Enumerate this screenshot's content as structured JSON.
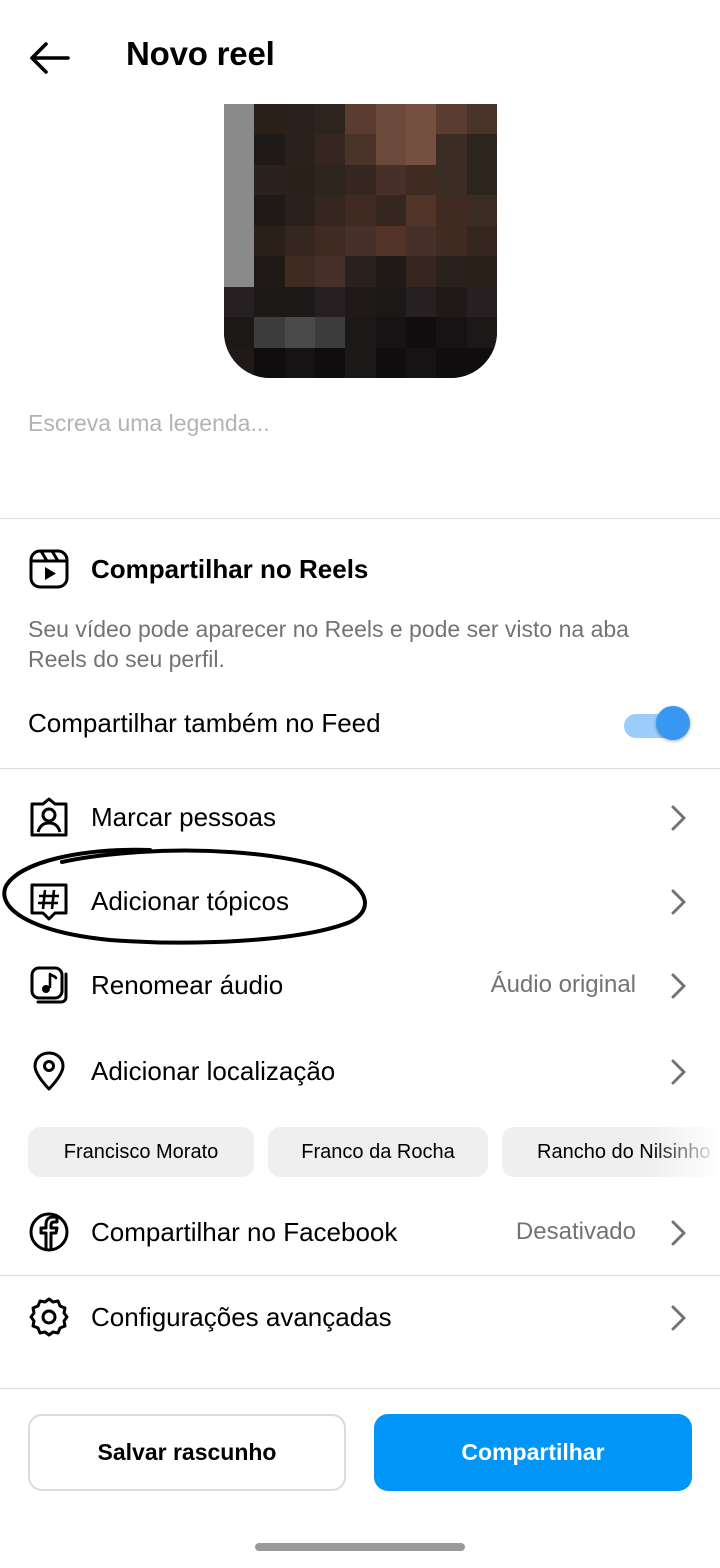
{
  "header": {
    "title": "Novo reel",
    "back_icon": "arrow-left-icon"
  },
  "caption": {
    "placeholder": "Escreva uma legenda..."
  },
  "reels_section": {
    "icon": "reels-icon",
    "title": "Compartilhar no Reels",
    "description": "Seu vídeo pode aparecer no Reels e pode ser visto na aba Reels do seu perfil.",
    "feed_toggle": {
      "label": "Compartilhar também no Feed",
      "on": true
    }
  },
  "options": {
    "tag_people": {
      "label": "Marcar pessoas",
      "icon": "tag-person-icon"
    },
    "add_topics": {
      "label": "Adicionar tópicos",
      "icon": "hashtag-icon"
    },
    "rename_audio": {
      "label": "Renomear áudio",
      "value": "Áudio original",
      "icon": "music-note-icon"
    },
    "add_location": {
      "label": "Adicionar localização",
      "icon": "location-pin-icon"
    },
    "share_facebook": {
      "label": "Compartilhar no Facebook",
      "value": "Desativado",
      "icon": "facebook-icon"
    },
    "advanced": {
      "label": "Configurações avançadas",
      "icon": "gear-icon"
    }
  },
  "location_suggestions": [
    "Francisco Morato",
    "Franco da Rocha",
    "Rancho do Nilsinho"
  ],
  "footer": {
    "draft_label": "Salvar rascunho",
    "share_label": "Compartilhar"
  },
  "colors": {
    "accent": "#0095f6",
    "toggle_knob": "#3897f0",
    "toggle_track": "#9ccdfa",
    "secondary_text": "#737373",
    "divider": "#dbdbdb",
    "chip_bg": "#efefef"
  }
}
